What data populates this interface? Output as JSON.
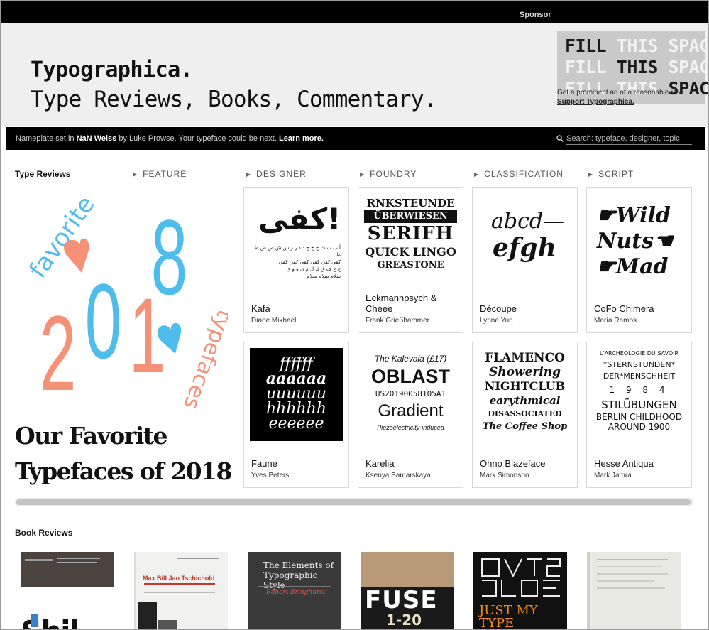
{
  "header": {
    "sponsor_label": "Sponsor",
    "logo_title": "Typographica.",
    "tagline": "Type Reviews, Books, Commentary."
  },
  "ad": {
    "lines": [
      [
        "FILL ",
        "THIS ",
        "SPACE"
      ],
      [
        "FILL ",
        "THIS ",
        "SPACE"
      ],
      [
        "FILL ",
        "THIS ",
        "SPACE"
      ]
    ],
    "note": "Get a prominent ad at a reasonable rate.",
    "link": "Support Typographica."
  },
  "infobar": {
    "prefix": "Nameplate set in ",
    "typeface": "NaN Weiss",
    "middle": " by Luke Prowse. Your typeface could be next. ",
    "learn_more": "Learn more.",
    "search_placeholder": "Search: typeface, designer, topic"
  },
  "type_reviews": {
    "title": "Type Reviews",
    "tabs": [
      "FEATURE",
      "DESIGNER",
      "FOUNDRY",
      "CLASSIFICATION",
      "SCRIPT"
    ],
    "feature": {
      "title_line1": "Our Favorite",
      "title_line2": "Typefaces of 2018",
      "art_words": [
        "favorite",
        "2018",
        "typefaces"
      ]
    },
    "cards": [
      {
        "name": "Kafa",
        "designer": "Diane Mikhael"
      },
      {
        "name": "Eckmannpsych & Cheee",
        "designer": "Frank Grießhammer"
      },
      {
        "name": "Découpe",
        "designer": "Lynne Yun"
      },
      {
        "name": "CoFo Chimera",
        "designer": "María Ramos"
      },
      {
        "name": "Faune",
        "designer": "Yves Peters"
      },
      {
        "name": "Karelia",
        "designer": "Ksenya Samarskaya"
      },
      {
        "name": "Ohno Blazeface",
        "designer": "Mark Simonson"
      },
      {
        "name": "Hesse Antiqua",
        "designer": "Mark Jamra"
      }
    ],
    "card_art": {
      "kafa": {
        "big": "كفى!",
        "lines": [
          "أ ب ت ث ج ح خ د ذ ر ز س ش ص ض ط ظ",
          "كفى كفى كفى كفى كفى كفى",
          "ع غ ف ق ك ل م ن ه و ي",
          "سلام سلام سلام"
        ]
      },
      "eckmann": [
        "RNKSTEUNDE",
        "ÜBERWIESEN",
        "SERIFH",
        "QUICK LINGO",
        "GREASTONE"
      ],
      "decoupe": [
        "abcd—",
        "efgh"
      ],
      "chimera": [
        "Wild",
        "Nuts",
        "Mad"
      ],
      "faune": [
        "ffffff",
        "aaaaaa",
        "uuuuuu",
        "hhhhhh",
        "eeeeee"
      ],
      "karelia": [
        "The Kalevala (£17)",
        "OBLAST",
        "US20190058105A1",
        "Gradient",
        "Piezoelectricity-induced"
      ],
      "blazeface": [
        "FLAMENCO",
        "Showering",
        "NIGHTCLUB",
        "earythmical",
        "DISASSOCIATED",
        "The Coffee Shop"
      ],
      "hesse": [
        "L'ARCHÉOLOGIE DU SAVOIR",
        "*STERNSTUNDEN*",
        "DER*MENSCHHEIT",
        "1 9 8 4",
        "STILÜBUNGEN",
        "BERLIN CHILDHOOD",
        "AROUND 1900"
      ]
    }
  },
  "book_reviews": {
    "title": "Book Reviews",
    "books": [
      {
        "cover_text": "Shil",
        "bg": "#ffffff"
      },
      {
        "cover_text": "Max Bill Jan Tschichold",
        "bg": "#f1f1ef"
      },
      {
        "cover_text": "The Elements of Typographic Style",
        "author": "Robert Bringhurst",
        "bg": "#3a3a3a"
      },
      {
        "cover_text": "FUSE",
        "sub": "1-20",
        "bg": "#b89a78"
      },
      {
        "cover_text": "JUST MY TYPE",
        "bg": "#111111"
      },
      {
        "cover_text": "",
        "bg": "#e9e9e4"
      }
    ]
  },
  "colors": {
    "pink": "#f59177",
    "blue": "#4fbdec",
    "black": "#000000",
    "masthead_bg": "#efefef"
  }
}
